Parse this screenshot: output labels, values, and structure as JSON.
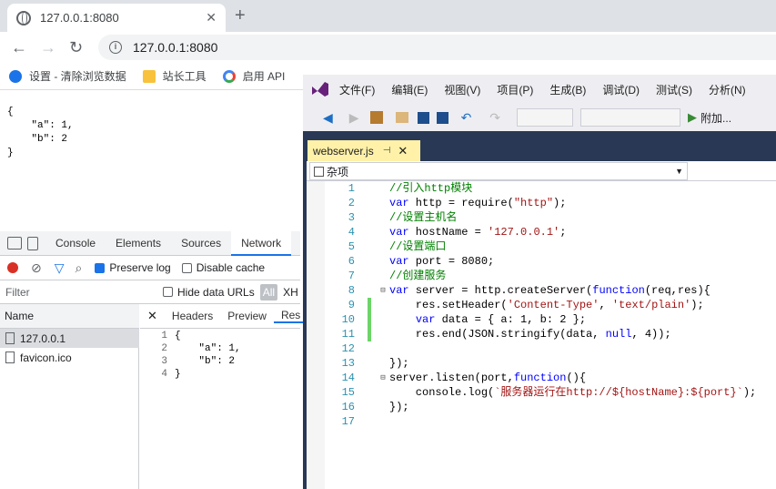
{
  "browser": {
    "tab_title": "127.0.0.1:8080",
    "url": "127.0.0.1:8080",
    "bookmarks": [
      {
        "label": "设置 - 清除浏览数据",
        "icon": "gear-icon",
        "color": "#1a73e8"
      },
      {
        "label": "站长工具",
        "icon": "folder-icon",
        "color": "#f9c23c"
      },
      {
        "label": "启用 API",
        "icon": "google-icon",
        "color": "#4285f4"
      }
    ]
  },
  "page_json": "{\n    \"a\": 1,\n    \"b\": 2\n}",
  "devtools": {
    "tabs": [
      "Console",
      "Elements",
      "Sources",
      "Network"
    ],
    "active_tab": "Network",
    "preserve_log": "Preserve log",
    "disable_cache": "Disable cache",
    "filter_placeholder": "Filter",
    "hide_data_urls": "Hide data URLs",
    "all": "All",
    "xhr": "XH",
    "name_header": "Name",
    "requests": [
      "127.0.0.1",
      "favicon.ico"
    ],
    "resp_tabs": [
      "Headers",
      "Preview",
      "Res"
    ],
    "response_lines": [
      {
        "n": "1",
        "t": "{"
      },
      {
        "n": "2",
        "t": "    \"a\": 1,"
      },
      {
        "n": "3",
        "t": "    \"b\": 2"
      },
      {
        "n": "4",
        "t": "}"
      }
    ]
  },
  "vs": {
    "menus": [
      "文件(F)",
      "编辑(E)",
      "视图(V)",
      "项目(P)",
      "生成(B)",
      "调试(D)",
      "测试(S)",
      "分析(N)"
    ],
    "attach": "附加...",
    "doc_tab": "webserver.js",
    "nav_scope": "杂项",
    "code_lines": [
      {
        "n": "1",
        "html": "<span class=\"c\">//引入http模块</span>"
      },
      {
        "n": "2",
        "html": "<span class=\"k\">var</span> http = require(<span class=\"s\">\"http\"</span>);"
      },
      {
        "n": "3",
        "html": "<span class=\"c\">//设置主机名</span>"
      },
      {
        "n": "4",
        "html": "<span class=\"k\">var</span> hostName = <span class=\"s\">'127.0.0.1'</span>;"
      },
      {
        "n": "5",
        "html": "<span class=\"c\">//设置端口</span>"
      },
      {
        "n": "6",
        "html": "<span class=\"k\">var</span> port = 8080;"
      },
      {
        "n": "7",
        "html": "<span class=\"c\">//创建服务</span>"
      },
      {
        "n": "8",
        "html": "<span class=\"k\">var</span> server = http.createServer(<span class=\"k\">function</span>(req,res){",
        "fold": true
      },
      {
        "n": "9",
        "html": "    res.setHeader(<span class=\"s\">'Content-Type'</span>, <span class=\"s\">'text/plain'</span>);",
        "green": true
      },
      {
        "n": "10",
        "html": "    <span class=\"k\">var</span> data = { a: 1, b: 2 };",
        "green": true
      },
      {
        "n": "11",
        "html": "    res.end(JSON.stringify(data, <span class=\"k\">null</span>, 4));",
        "green": true
      },
      {
        "n": "12",
        "html": ""
      },
      {
        "n": "13",
        "html": "});"
      },
      {
        "n": "14",
        "html": "server.listen(port,<span class=\"k\">function</span>(){",
        "fold": true
      },
      {
        "n": "15",
        "html": "    console.log(<span class=\"s\">`服务器运行在http://${hostName}:${port}`</span>);"
      },
      {
        "n": "16",
        "html": "});"
      },
      {
        "n": "17",
        "html": ""
      }
    ]
  }
}
